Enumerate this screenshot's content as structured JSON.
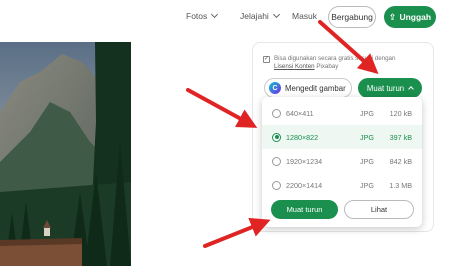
{
  "nav": {
    "photos_label": "Fotos",
    "explore_label": "Jelajahi",
    "login_label": "Masuk",
    "join_label": "Bergabung",
    "upload_label": "Unggah",
    "upload_icon": "upload-arrow"
  },
  "panel": {
    "license_text": "Bisa digunakan secara gratis sesuai dengan",
    "license_link": "Lisensi Konten",
    "license_suffix": "Pixabay",
    "edit_label": "Mengedit gambar",
    "edit_logo_letter": "C",
    "download_label": "Muat turun"
  },
  "dropdown": {
    "options": [
      {
        "dims": "640×411",
        "format": "JPG",
        "size": "120 kB",
        "selected": false
      },
      {
        "dims": "1280×822",
        "format": "JPG",
        "size": "397 kB",
        "selected": true
      },
      {
        "dims": "1920×1234",
        "format": "JPG",
        "size": "842 kB",
        "selected": false
      },
      {
        "dims": "2200×1414",
        "format": "JPG",
        "size": "1.3 MB",
        "selected": false
      }
    ],
    "download_label": "Muat turun",
    "view_label": "Lihat"
  },
  "colors": {
    "accent": "#1a8f4e",
    "annotation_arrow": "#e02424"
  }
}
